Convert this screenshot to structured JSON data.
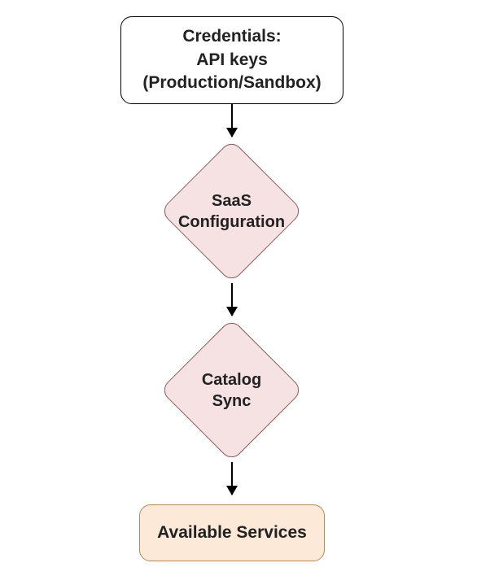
{
  "nodes": {
    "credentials": {
      "title": "Credentials:",
      "subtitle": "API keys (Production/Sandbox)"
    },
    "saas_config": {
      "label": "SaaS Configuration"
    },
    "catalog_sync": {
      "label": "Catalog Sync"
    },
    "available_services": {
      "label": "Available Services"
    }
  },
  "colors": {
    "diamond_fill": "#f6e1e3",
    "diamond_border": "#8b5d5d",
    "final_fill": "#fce9d8",
    "final_border": "#b48a5a"
  }
}
